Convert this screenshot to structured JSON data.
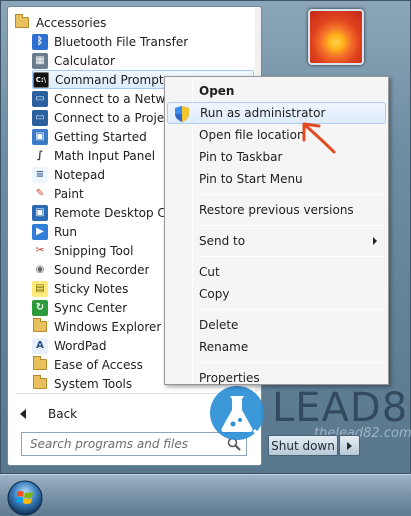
{
  "start_menu": {
    "programs": [
      {
        "label": "Accessories",
        "icon": "folder-icon",
        "indent": false,
        "top": 0
      },
      {
        "label": "Bluetooth File Transfer",
        "icon": "bluetooth-icon",
        "indent": true
      },
      {
        "label": "Calculator",
        "icon": "calculator-icon",
        "indent": true
      },
      {
        "label": "Command Prompt",
        "icon": "command-prompt-icon",
        "indent": true,
        "highlighted": true
      },
      {
        "label": "Connect to a Network Projector",
        "icon": "network-projector-icon",
        "indent": true
      },
      {
        "label": "Connect to a Projector",
        "icon": "projector-icon",
        "indent": true
      },
      {
        "label": "Getting Started",
        "icon": "getting-started-icon",
        "indent": true
      },
      {
        "label": "Math Input Panel",
        "icon": "math-input-icon",
        "indent": true
      },
      {
        "label": "Notepad",
        "icon": "notepad-icon",
        "indent": true
      },
      {
        "label": "Paint",
        "icon": "paint-icon",
        "indent": true
      },
      {
        "label": "Remote Desktop Connection",
        "icon": "remote-desktop-icon",
        "indent": true
      },
      {
        "label": "Run",
        "icon": "run-icon",
        "indent": true
      },
      {
        "label": "Snipping Tool",
        "icon": "scissors-icon",
        "indent": true
      },
      {
        "label": "Sound Recorder",
        "icon": "microphone-icon",
        "indent": true
      },
      {
        "label": "Sticky Notes",
        "icon": "sticky-notes-icon",
        "indent": true
      },
      {
        "label": "Sync Center",
        "icon": "sync-icon",
        "indent": true
      },
      {
        "label": "Windows Explorer",
        "icon": "explorer-folder-icon",
        "indent": true
      },
      {
        "label": "WordPad",
        "icon": "wordpad-icon",
        "indent": true
      },
      {
        "label": "Ease of Access",
        "icon": "folder-icon",
        "indent": true
      },
      {
        "label": "System Tools",
        "icon": "folder-icon",
        "indent": true
      }
    ],
    "back_label": "Back",
    "search_placeholder": "Search programs and files",
    "shutdown_label": "Shut down"
  },
  "context_menu": {
    "items": [
      {
        "label": "Open",
        "bold": true
      },
      {
        "label": "Run as administrator",
        "highlighted": true,
        "icon": "uac-shield-icon"
      },
      {
        "label": "Open file location"
      },
      {
        "label": "Pin to Taskbar"
      },
      {
        "label": "Pin to Start Menu"
      },
      {
        "separator": true
      },
      {
        "label": "Restore previous versions"
      },
      {
        "separator": true
      },
      {
        "label": "Send to",
        "submenu": true
      },
      {
        "separator": true
      },
      {
        "label": "Cut"
      },
      {
        "label": "Copy"
      },
      {
        "separator": true
      },
      {
        "label": "Delete"
      },
      {
        "label": "Rename"
      },
      {
        "separator": true
      },
      {
        "label": "Properties"
      }
    ]
  },
  "watermark": {
    "text": "LEAD8",
    "subtext": "thelead82.com"
  },
  "colors": {
    "highlight_border": "#a6c8ee",
    "annotation_arrow": "#e34a1f",
    "watermark_blue": "#2d8fd6"
  }
}
